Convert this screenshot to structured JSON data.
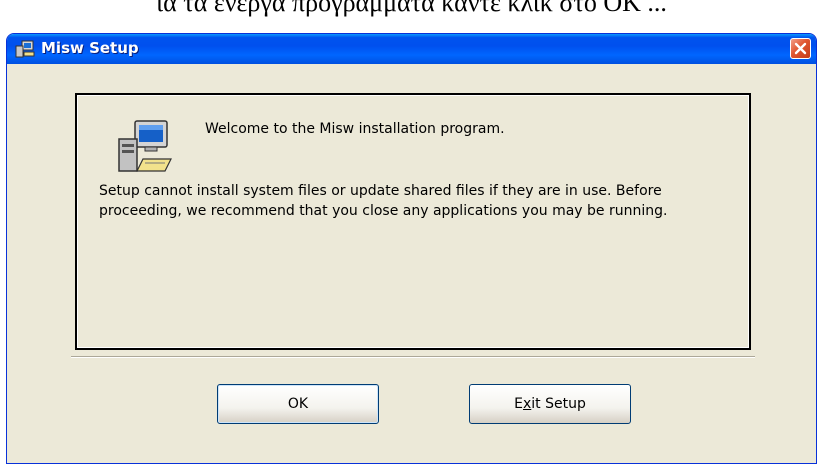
{
  "caption": "ια τα ενεργά προγράμματα κάντε κλικ στο OK ...",
  "window": {
    "title": "Misw Setup",
    "welcome": "Welcome to the Misw installation program.",
    "message": "Setup cannot install system files or update shared files if they are in use. Before proceeding, we recommend that you close any applications you may be running."
  },
  "buttons": {
    "ok_label": "OK",
    "exit_prefix": "E",
    "exit_mnemonic": "x",
    "exit_suffix": "it Setup"
  },
  "icons": {
    "title": "setup-computer-icon",
    "close": "close-icon",
    "main": "setup-computer-icon"
  },
  "colors": {
    "titlebar": "#0053ee",
    "window_bg": "#ece9d8",
    "close": "#e0552f"
  }
}
